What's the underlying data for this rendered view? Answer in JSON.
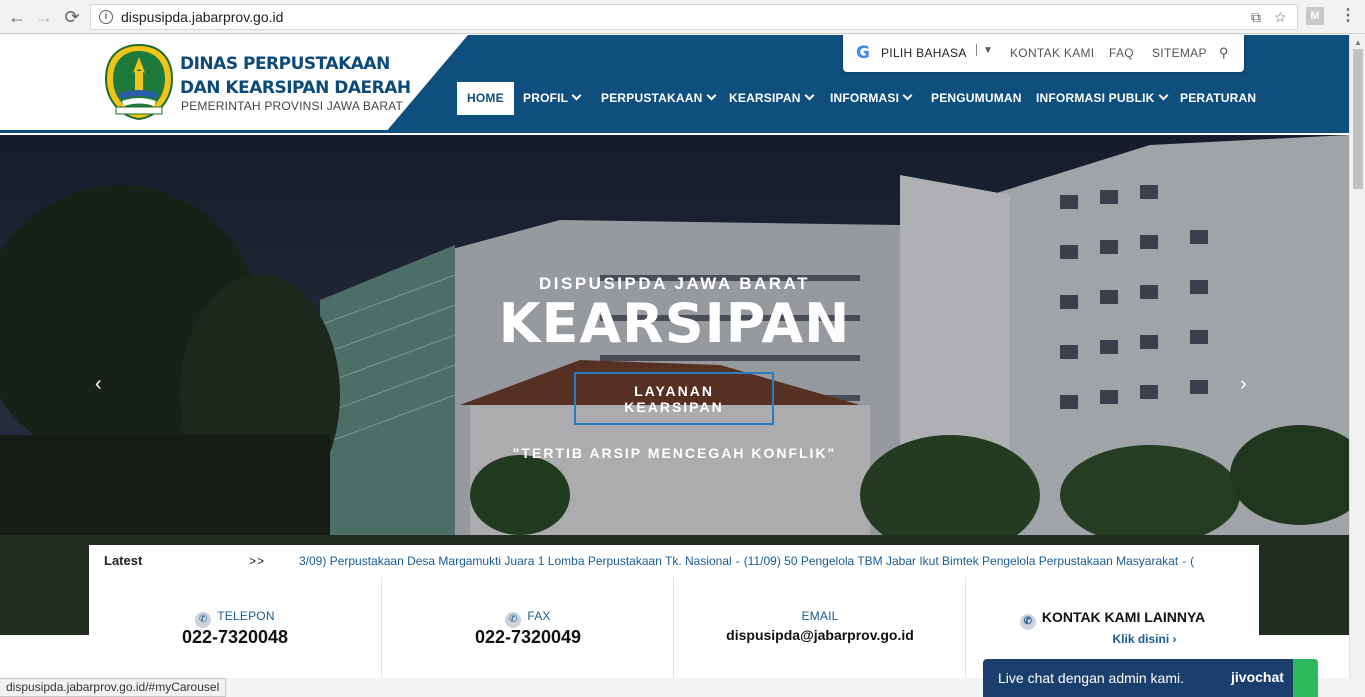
{
  "browser": {
    "url": "dispusipda.jabarprov.go.id",
    "status_url": "dispusipda.jabarprov.go.id/#myCarousel",
    "extension_label": "M"
  },
  "header": {
    "title_line1": "DINAS PERPUSTAKAAN",
    "title_line2": "DAN KEARSIPAN DAERAH",
    "subtitle": "PEMERINTAH PROVINSI JAWA BARAT"
  },
  "topbar": {
    "language_label": "PILIH BAHASA",
    "links": [
      "KONTAK KAMI",
      "FAQ",
      "SITEMAP"
    ]
  },
  "nav": {
    "items": [
      {
        "label": "HOME"
      },
      {
        "label": "PROFIL"
      },
      {
        "label": "PERPUSTAKAAN"
      },
      {
        "label": "KEARSIPAN"
      },
      {
        "label": "INFORMASI"
      },
      {
        "label": "PENGUMUMAN"
      },
      {
        "label": "INFORMASI PUBLIK"
      },
      {
        "label": "PERATURAN"
      }
    ]
  },
  "hero": {
    "kicker": "DISPUSIPDA JAWA BARAT",
    "title": "KEARSIPAN",
    "button_line1": "LAYANAN",
    "button_line2": "KEARSIPAN",
    "quote": "\"TERTIB ARSIP MENCEGAH KONFLIK\"",
    "prev": "‹",
    "next": "›"
  },
  "ticker": {
    "label": "Latest",
    "arrows": ">>",
    "items": [
      "3/09) Perpustakaan Desa Margamukti Juara 1 Lomba Perpustakaan Tk. Nasional",
      "(11/09) 50 Pengelola TBM Jabar Ikut Bimtek Pengelola Perpustakaan Masyarakat",
      "("
    ],
    "separator": "-"
  },
  "contacts": {
    "phone_label": "TELEPON",
    "phone": "022-7320048",
    "fax_label": "FAX",
    "fax": "022-7320049",
    "email_label": "EMAIL",
    "email": "dispusipda@jabarprov.go.id",
    "more_label": "KONTAK KAMI LAINNYA",
    "more_link": "Klik disini"
  },
  "livechat": {
    "text": "Live chat dengan admin kami.",
    "brand": "jivochat"
  },
  "colors": {
    "brand_blue": "#0e4f7e",
    "link_blue": "#1a5c94",
    "chat_bg": "#1a3f6d",
    "chat_accent": "#2eb85c"
  }
}
